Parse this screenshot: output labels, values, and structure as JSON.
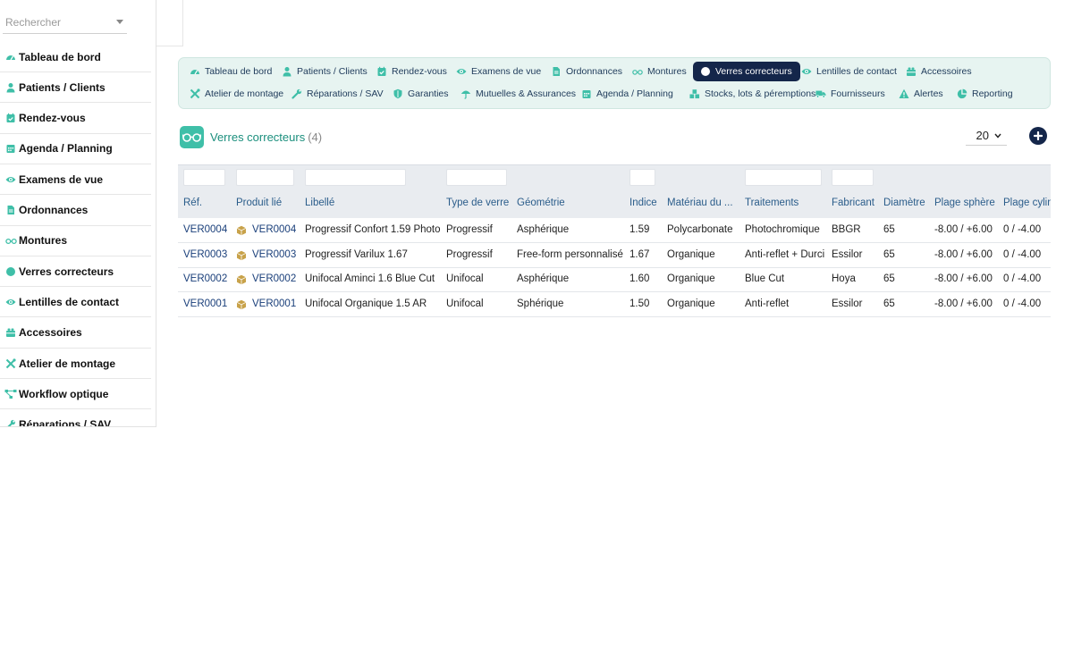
{
  "search": {
    "placeholder": "Rechercher"
  },
  "sidebar": {
    "items": [
      {
        "label": "Tableau de bord",
        "icon": "gauge-icon"
      },
      {
        "label": "Patients / Clients",
        "icon": "user-icon"
      },
      {
        "label": "Rendez-vous",
        "icon": "calendar-check-icon"
      },
      {
        "label": "Agenda / Planning",
        "icon": "calendar-icon"
      },
      {
        "label": "Examens de vue",
        "icon": "eye-icon"
      },
      {
        "label": "Ordonnances",
        "icon": "prescription-icon"
      },
      {
        "label": "Montures",
        "icon": "glasses-icon"
      },
      {
        "label": "Verres correcteurs",
        "icon": "circle-icon"
      },
      {
        "label": "Lentilles de contact",
        "icon": "eye-icon"
      },
      {
        "label": "Accessoires",
        "icon": "gift-icon"
      },
      {
        "label": "Atelier de montage",
        "icon": "tools-icon"
      },
      {
        "label": "Workflow optique",
        "icon": "workflow-icon"
      },
      {
        "label": "Réparations / SAV",
        "icon": "wrench-icon"
      }
    ]
  },
  "tabs": {
    "row1": [
      {
        "label": "Tableau de bord",
        "icon": "gauge-icon"
      },
      {
        "label": "Patients / Clients",
        "icon": "user-icon"
      },
      {
        "label": "Rendez-vous",
        "icon": "calendar-check-icon"
      },
      {
        "label": "Examens de vue",
        "icon": "eye-icon"
      },
      {
        "label": "Ordonnances",
        "icon": "prescription-icon"
      },
      {
        "label": "Montures",
        "icon": "glasses-icon"
      },
      {
        "label": "Verres correcteurs",
        "icon": "circle-icon",
        "active": true
      },
      {
        "label": "Lentilles de contact",
        "icon": "eye-icon"
      },
      {
        "label": "Accessoires",
        "icon": "gift-icon"
      }
    ],
    "row2": [
      {
        "label": "Atelier de montage",
        "icon": "tools-icon"
      },
      {
        "label": "Réparations / SAV",
        "icon": "wrench-icon"
      },
      {
        "label": "Garanties",
        "icon": "shield-icon"
      },
      {
        "label": "Mutuelles & Assurances",
        "icon": "umbrella-icon"
      },
      {
        "label": "Agenda / Planning",
        "icon": "calendar-icon"
      },
      {
        "label": "Stocks, lots & péremptions",
        "icon": "boxes-icon"
      },
      {
        "label": "Fournisseurs",
        "icon": "truck-icon"
      },
      {
        "label": "Alertes",
        "icon": "warning-icon"
      },
      {
        "label": "Reporting",
        "icon": "pie-chart-icon"
      }
    ]
  },
  "header": {
    "title": "Verres correcteurs",
    "count": "(4)",
    "page_size": "20",
    "icon": "glasses-icon"
  },
  "table": {
    "columns": [
      "Réf.",
      "Produit lié",
      "Libellé",
      "Type de verre",
      "Géométrie",
      "Indice",
      "Matériau du ...",
      "Traitements",
      "Fabricant",
      "Diamètre",
      "Plage sphère",
      "Plage cylin"
    ],
    "rows": [
      [
        "VER0004",
        "VER0004",
        "Progressif Confort 1.59 Photo",
        "Progressif",
        "Asphérique",
        "1.59",
        "Polycarbonate",
        "Photochromique",
        "BBGR",
        "65",
        "-8.00 / +6.00",
        "0 / -4.00"
      ],
      [
        "VER0003",
        "VER0003",
        "Progressif Varilux 1.67",
        "Progressif",
        "Free-form personnalisé",
        "1.67",
        "Organique",
        "Anti-reflet + Durci",
        "Essilor",
        "65",
        "-8.00 / +6.00",
        "0 / -4.00"
      ],
      [
        "VER0002",
        "VER0002",
        "Unifocal Aminci 1.6 Blue Cut",
        "Unifocal",
        "Asphérique",
        "1.60",
        "Organique",
        "Blue Cut",
        "Hoya",
        "65",
        "-8.00 / +6.00",
        "0 / -4.00"
      ],
      [
        "VER0001",
        "VER0001",
        "Unifocal Organique 1.5 AR",
        "Unifocal",
        "Sphérique",
        "1.50",
        "Organique",
        "Anti-reflet",
        "Essilor",
        "65",
        "-8.00 / +6.00",
        "0 / -4.00"
      ]
    ]
  },
  "colors": {
    "accent": "#3fbfa8",
    "title_teal": "#1b8f7d",
    "nav_dark": "#14264a",
    "link": "#1a3f7a",
    "product_icon": "#c8a24a"
  }
}
